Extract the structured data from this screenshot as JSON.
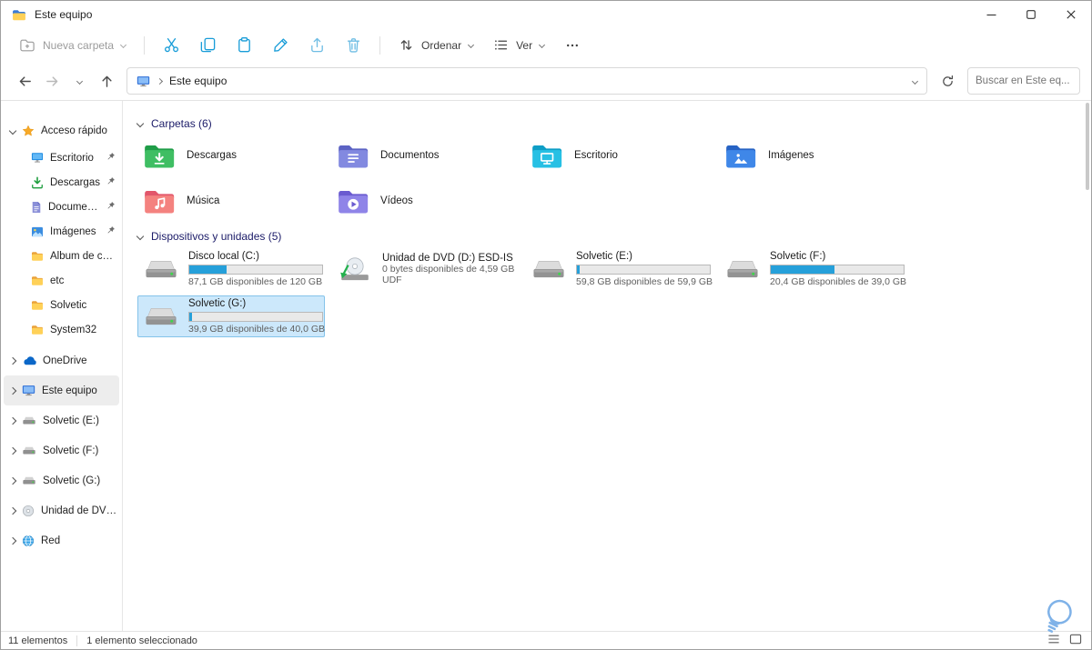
{
  "colors": {
    "accent_progress": "#26a0da",
    "selection_bg": "#cce8fb",
    "selection_border": "#84c3ea",
    "section_header_text": "#1b1b68"
  },
  "window": {
    "title": "Este equipo"
  },
  "toolbar": {
    "new_folder_label": "Nueva carpeta",
    "sort_label": "Ordenar",
    "view_label": "Ver",
    "icons": [
      "cut",
      "copy",
      "paste",
      "rename",
      "share",
      "delete",
      "sort",
      "view",
      "more"
    ]
  },
  "navbar": {
    "breadcrumb_root": "Este equipo",
    "search_placeholder": "Buscar en Este eq..."
  },
  "sidebar": {
    "quick_access_label": "Acceso rápido",
    "quick_access": [
      {
        "label": "Escritorio",
        "icon": "desktop-icon",
        "pinned": true
      },
      {
        "label": "Descargas",
        "icon": "downloads-icon",
        "pinned": true
      },
      {
        "label": "Documentos",
        "icon": "document-icon",
        "pinned": true
      },
      {
        "label": "Imágenes",
        "icon": "pictures-icon",
        "pinned": true
      },
      {
        "label": "Álbum de cámara",
        "icon": "folder-icon",
        "pinned": false
      },
      {
        "label": "etc",
        "icon": "folder-icon",
        "pinned": false
      },
      {
        "label": "Solvetic",
        "icon": "folder-icon",
        "pinned": false
      },
      {
        "label": "System32",
        "icon": "folder-icon",
        "pinned": false
      }
    ],
    "roots": [
      {
        "label": "OneDrive",
        "icon": "onedrive-icon",
        "selected": false
      },
      {
        "label": "Este equipo",
        "icon": "computer-icon",
        "selected": true
      },
      {
        "label": "Solvetic (E:)",
        "icon": "drive-icon",
        "selected": false
      },
      {
        "label": "Solvetic (F:)",
        "icon": "drive-icon",
        "selected": false
      },
      {
        "label": "Solvetic (G:)",
        "icon": "drive-icon",
        "selected": false
      },
      {
        "label": "Unidad de DVD (D:)",
        "icon": "dvd-icon",
        "selected": false
      },
      {
        "label": "Red",
        "icon": "network-icon",
        "selected": false
      }
    ]
  },
  "content": {
    "folders": {
      "title": "Carpetas (6)",
      "items": [
        {
          "label": "Descargas",
          "icon": "downloads-folder-icon"
        },
        {
          "label": "Documentos",
          "icon": "documents-folder-icon"
        },
        {
          "label": "Escritorio",
          "icon": "desktop-folder-icon"
        },
        {
          "label": "Imágenes",
          "icon": "pictures-folder-icon"
        },
        {
          "label": "Música",
          "icon": "music-folder-icon"
        },
        {
          "label": "Vídeos",
          "icon": "videos-folder-icon"
        }
      ]
    },
    "drives": {
      "title": "Dispositivos y unidades (5)",
      "items": [
        {
          "name": "Disco local (C:)",
          "detail": "87,1 GB disponibles de 120 GB",
          "fill_percent": 28,
          "type": "hdd",
          "selected": false
        },
        {
          "name": "Unidad de DVD (D:) ESD-ISO",
          "detail": "0 bytes disponibles de 4,59 GB",
          "filesystem": "UDF",
          "type": "dvd",
          "selected": false
        },
        {
          "name": "Solvetic (E:)",
          "detail": "59,8 GB disponibles de 59,9 GB",
          "fill_percent": 2,
          "type": "hdd",
          "selected": false
        },
        {
          "name": "Solvetic (F:)",
          "detail": "20,4 GB disponibles de 39,0 GB",
          "fill_percent": 48,
          "type": "hdd",
          "selected": false
        },
        {
          "name": "Solvetic (G:)",
          "detail": "39,9 GB disponibles de 40,0 GB",
          "fill_percent": 2,
          "type": "hdd",
          "selected": true
        }
      ]
    }
  },
  "statusbar": {
    "item_count": "11 elementos",
    "selection": "1 elemento seleccionado"
  }
}
